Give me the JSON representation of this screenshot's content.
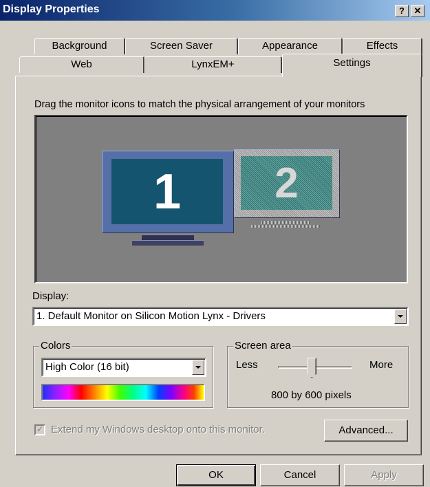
{
  "window": {
    "title": "Display Properties",
    "help_label": "?",
    "close_label": "✕"
  },
  "tabs": {
    "row1": [
      {
        "label": "Background"
      },
      {
        "label": "Screen Saver"
      },
      {
        "label": "Appearance"
      },
      {
        "label": "Effects"
      }
    ],
    "row2": [
      {
        "label": "Web"
      },
      {
        "label": "LynxEM+"
      },
      {
        "label": "Settings",
        "selected": true
      }
    ]
  },
  "settings": {
    "instruction": "Drag the monitor icons to match the physical arrangement of your monitors",
    "monitors": [
      {
        "number": "1",
        "primary": true
      },
      {
        "number": "2",
        "primary": false
      }
    ],
    "display_label": "Display:",
    "display_value": "1. Default Monitor on Silicon Motion Lynx - Drivers",
    "colors": {
      "legend": "Colors",
      "value": "High Color (16 bit)"
    },
    "screen_area": {
      "legend": "Screen area",
      "less_label": "Less",
      "more_label": "More",
      "value_text": "800 by 600 pixels",
      "slider_position": 0.45
    },
    "extend_desktop": {
      "label": "Extend my Windows desktop onto this monitor.",
      "checked": true,
      "disabled": true,
      "check_glyph": "✓"
    },
    "advanced_label": "Advanced..."
  },
  "footer": {
    "ok_label": "OK",
    "cancel_label": "Cancel",
    "apply_label": "Apply"
  },
  "colors_theme": {
    "titlebar_start": "#0a246a",
    "titlebar_end": "#a6caf0",
    "face": "#d4d0c8",
    "monitor1_screen": "#14546e",
    "monitor2_screen": "#3a8a84"
  }
}
